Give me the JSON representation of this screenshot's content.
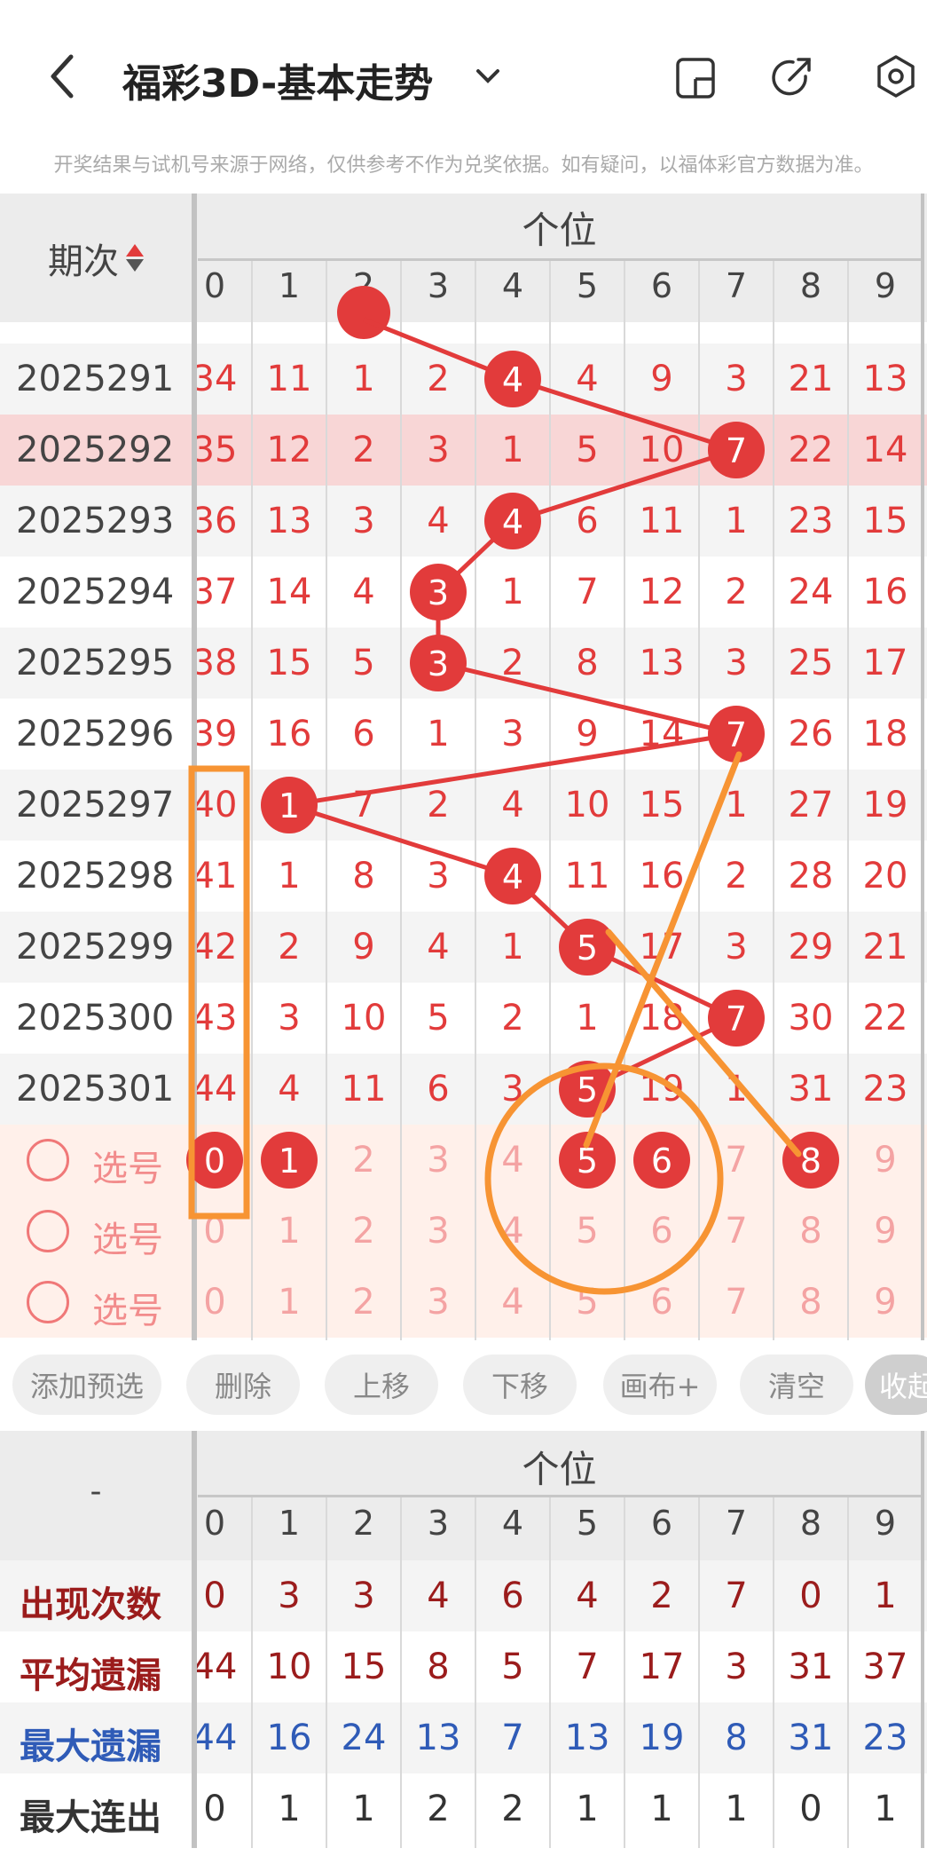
{
  "header": {
    "title": "福彩3D-基本走势",
    "notice": "开奖结果与试机号来源于网络，仅供参考不作为兑奖依据。如有疑问，以福体彩官方数据为准。"
  },
  "grid": {
    "period_header": "期次",
    "group_label": "个位",
    "digit_headers": [
      "0",
      "1",
      "2",
      "3",
      "4",
      "5",
      "6",
      "7",
      "8",
      "9"
    ],
    "rows": [
      {
        "period": "2025291",
        "cells": [
          "34",
          "11",
          "1",
          "2",
          "4",
          "4",
          "9",
          "3",
          "21",
          "13"
        ],
        "hit": 4
      },
      {
        "period": "2025292",
        "cells": [
          "35",
          "12",
          "2",
          "3",
          "1",
          "5",
          "10",
          "7",
          "22",
          "14"
        ],
        "hit": 7,
        "highlight": true
      },
      {
        "period": "2025293",
        "cells": [
          "36",
          "13",
          "3",
          "4",
          "4",
          "6",
          "11",
          "1",
          "23",
          "15"
        ],
        "hit": 4
      },
      {
        "period": "2025294",
        "cells": [
          "37",
          "14",
          "4",
          "3",
          "1",
          "7",
          "12",
          "2",
          "24",
          "16"
        ],
        "hit": 3
      },
      {
        "period": "2025295",
        "cells": [
          "38",
          "15",
          "5",
          "3",
          "2",
          "8",
          "13",
          "3",
          "25",
          "17"
        ],
        "hit": 3
      },
      {
        "period": "2025296",
        "cells": [
          "39",
          "16",
          "6",
          "1",
          "3",
          "9",
          "14",
          "7",
          "26",
          "18"
        ],
        "hit": 7
      },
      {
        "period": "2025297",
        "cells": [
          "40",
          "1",
          "7",
          "2",
          "4",
          "10",
          "15",
          "1",
          "27",
          "19"
        ],
        "hit": 1
      },
      {
        "period": "2025298",
        "cells": [
          "41",
          "1",
          "8",
          "3",
          "4",
          "11",
          "16",
          "2",
          "28",
          "20"
        ],
        "hit": 4
      },
      {
        "period": "2025299",
        "cells": [
          "42",
          "2",
          "9",
          "4",
          "1",
          "5",
          "17",
          "3",
          "29",
          "21"
        ],
        "hit": 5
      },
      {
        "period": "2025300",
        "cells": [
          "43",
          "3",
          "10",
          "5",
          "2",
          "1",
          "18",
          "7",
          "30",
          "22"
        ],
        "hit": 7
      },
      {
        "period": "2025301",
        "cells": [
          "44",
          "4",
          "11",
          "6",
          "3",
          "5",
          "19",
          "1",
          "31",
          "23"
        ],
        "hit": 5
      }
    ],
    "select_rows": [
      {
        "label": "选号",
        "cells": [
          "0",
          "1",
          "2",
          "3",
          "4",
          "5",
          "6",
          "7",
          "8",
          "9"
        ],
        "selected": [
          0,
          1,
          5,
          6,
          8
        ]
      },
      {
        "label": "选号",
        "cells": [
          "0",
          "1",
          "2",
          "3",
          "4",
          "5",
          "6",
          "7",
          "8",
          "9"
        ],
        "selected": []
      },
      {
        "label": "选号",
        "cells": [
          "0",
          "1",
          "2",
          "3",
          "4",
          "5",
          "6",
          "7",
          "8",
          "9"
        ],
        "selected": []
      }
    ]
  },
  "actions": [
    "添加预选",
    "删除",
    "上移",
    "下移",
    "画布+",
    "清空",
    "收起"
  ],
  "stats": {
    "corner": "-",
    "group_label": "个位",
    "digit_headers": [
      "0",
      "1",
      "2",
      "3",
      "4",
      "5",
      "6",
      "7",
      "8",
      "9"
    ],
    "rows": [
      {
        "label": "出现次数",
        "values": [
          "0",
          "3",
          "3",
          "4",
          "6",
          "4",
          "2",
          "7",
          "0",
          "1"
        ],
        "color": "#9b1c1c"
      },
      {
        "label": "平均遗漏",
        "values": [
          "44",
          "10",
          "15",
          "8",
          "5",
          "7",
          "17",
          "3",
          "31",
          "37"
        ],
        "color": "#9b1c1c"
      },
      {
        "label": "最大遗漏",
        "values": [
          "44",
          "16",
          "24",
          "13",
          "7",
          "13",
          "19",
          "8",
          "31",
          "23"
        ],
        "color": "#2f5bb7"
      },
      {
        "label": "最大连出",
        "values": [
          "0",
          "1",
          "1",
          "2",
          "2",
          "1",
          "1",
          "1",
          "0",
          "1"
        ],
        "color": "#333333"
      }
    ]
  },
  "colors": {
    "hit": "#e23b3b",
    "annotation": "#f79433",
    "highlight_row": "#f8d6d6"
  }
}
